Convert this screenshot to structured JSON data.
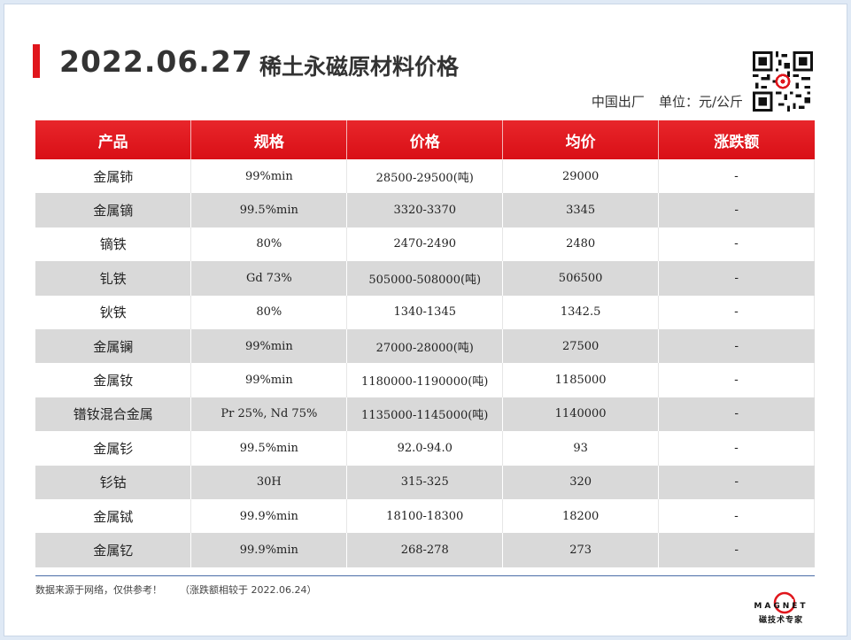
{
  "header": {
    "date": "2022.06.27",
    "title": "稀土永磁原材料价格",
    "origin": "中国出厂",
    "unit": "单位：元/公斤"
  },
  "table": {
    "headers": [
      "产品",
      "规格",
      "价格",
      "均价",
      "涨跌额"
    ],
    "rows": [
      [
        "金属铈",
        "99%min",
        "28500-29500(吨)",
        "29000",
        "-"
      ],
      [
        "金属镝",
        "99.5%min",
        "3320-3370",
        "3345",
        "-"
      ],
      [
        "镝铁",
        "80%",
        "2470-2490",
        "2480",
        "-"
      ],
      [
        "钆铁",
        "Gd 73%",
        "505000-508000(吨)",
        "506500",
        "-"
      ],
      [
        "钬铁",
        "80%",
        "1340-1345",
        "1342.5",
        "-"
      ],
      [
        "金属镧",
        "99%min",
        "27000-28000(吨)",
        "27500",
        "-"
      ],
      [
        "金属钕",
        "99%min",
        "1180000-1190000(吨)",
        "1185000",
        "-"
      ],
      [
        "镨钕混合金属",
        "Pr 25%, Nd 75%",
        "1135000-1145000(吨)",
        "1140000",
        "-"
      ],
      [
        "金属钐",
        "99.5%min",
        "92.0-94.0",
        "93",
        "-"
      ],
      [
        "钐钴",
        "30H",
        "315-325",
        "320",
        "-"
      ],
      [
        "金属铽",
        "99.9%min",
        "18100-18300",
        "18200",
        "-"
      ],
      [
        "金属钇",
        "99.9%min",
        "268-278",
        "273",
        "-"
      ]
    ]
  },
  "footer": {
    "source_note": "数据来源于网络，仅供参考！",
    "compare_note": "（涨跌额相较于 2022.06.24）",
    "logo_text": "MAGNET",
    "logo_sub": "磁技术专家"
  },
  "icons": {
    "qr": "qr-code-icon",
    "logo": "magnet-logo-icon"
  },
  "colors": {
    "accent": "#e0161c",
    "row_alt": "#d9d9d9"
  }
}
